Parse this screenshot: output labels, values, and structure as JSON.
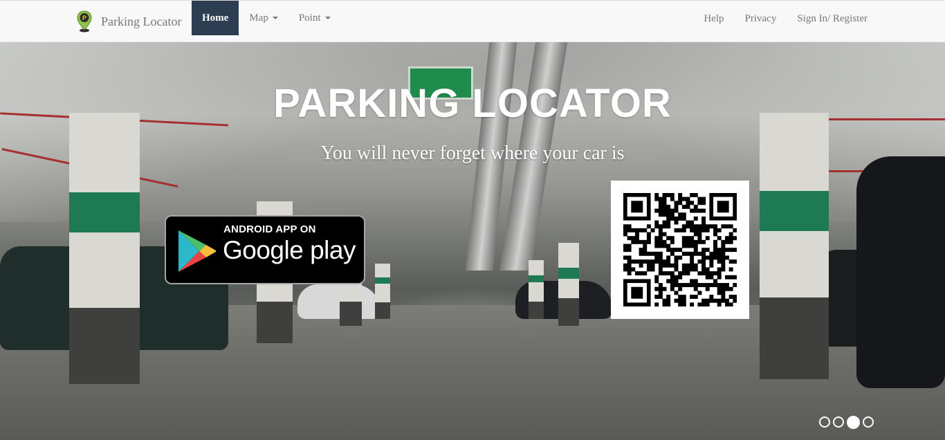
{
  "nav": {
    "brand_name": "Parking Locator",
    "logo_icon": "parking-pin-icon",
    "left_items": [
      {
        "label": "Home",
        "active": true,
        "dropdown": false
      },
      {
        "label": "Map",
        "active": false,
        "dropdown": true
      },
      {
        "label": "Point",
        "active": false,
        "dropdown": true
      }
    ],
    "right_items": [
      {
        "label": "Help"
      },
      {
        "label": "Privacy"
      },
      {
        "label": "Sign In/ Register"
      }
    ],
    "active_color": "#2e3e52"
  },
  "hero": {
    "title": "PARKING LOCATOR",
    "subtitle": "You will never forget where your car is",
    "store_badge": {
      "small_text": "ANDROID APP ON",
      "big_text": "Google play",
      "icon": "google-play-icon"
    },
    "qr_icon": "qr-code",
    "carousel": {
      "slide_count": 4,
      "active_index": 2
    }
  }
}
